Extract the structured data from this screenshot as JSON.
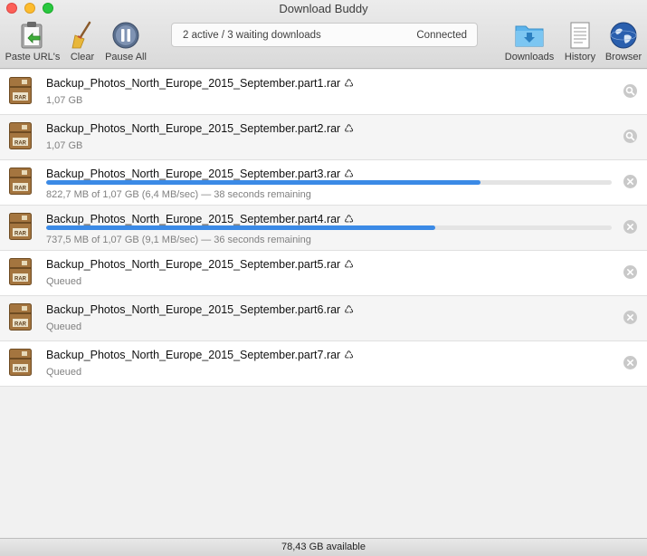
{
  "window": {
    "title": "Download Buddy"
  },
  "toolbar": {
    "paste_label": "Paste URL's",
    "clear_label": "Clear",
    "pause_label": "Pause All",
    "downloads_label": "Downloads",
    "history_label": "History",
    "browser_label": "Browser"
  },
  "status": {
    "summary": "2 active / 3 waiting downloads",
    "connection": "Connected"
  },
  "downloads": [
    {
      "name": "Backup_Photos_North_Europe_2015_September.part1.rar",
      "detail": "1,07 GB",
      "state": "complete",
      "progress": null
    },
    {
      "name": "Backup_Photos_North_Europe_2015_September.part2.rar",
      "detail": "1,07 GB",
      "state": "complete",
      "progress": null
    },
    {
      "name": "Backup_Photos_North_Europe_2015_September.part3.rar",
      "detail": "822,7 MB of 1,07 GB (6,4 MB/sec) — 38 seconds remaining",
      "state": "active",
      "progress": 0.768
    },
    {
      "name": "Backup_Photos_North_Europe_2015_September.part4.rar",
      "detail": "737,5 MB of 1,07 GB (9,1 MB/sec) — 36 seconds remaining",
      "state": "active",
      "progress": 0.688
    },
    {
      "name": "Backup_Photos_North_Europe_2015_September.part5.rar",
      "detail": "Queued",
      "state": "queued",
      "progress": null
    },
    {
      "name": "Backup_Photos_North_Europe_2015_September.part6.rar",
      "detail": "Queued",
      "state": "queued",
      "progress": null
    },
    {
      "name": "Backup_Photos_North_Europe_2015_September.part7.rar",
      "detail": "Queued",
      "state": "queued",
      "progress": null
    }
  ],
  "footer": {
    "available": "78,43 GB available"
  },
  "icons": {
    "file": "rar-archive-icon",
    "complete_action": "magnifier-icon",
    "cancel_action": "cancel-icon",
    "name_suffix": "recycle-icon"
  },
  "colors": {
    "progress": "#3b8ae6",
    "toolbar_accent": "#4a90d9"
  }
}
